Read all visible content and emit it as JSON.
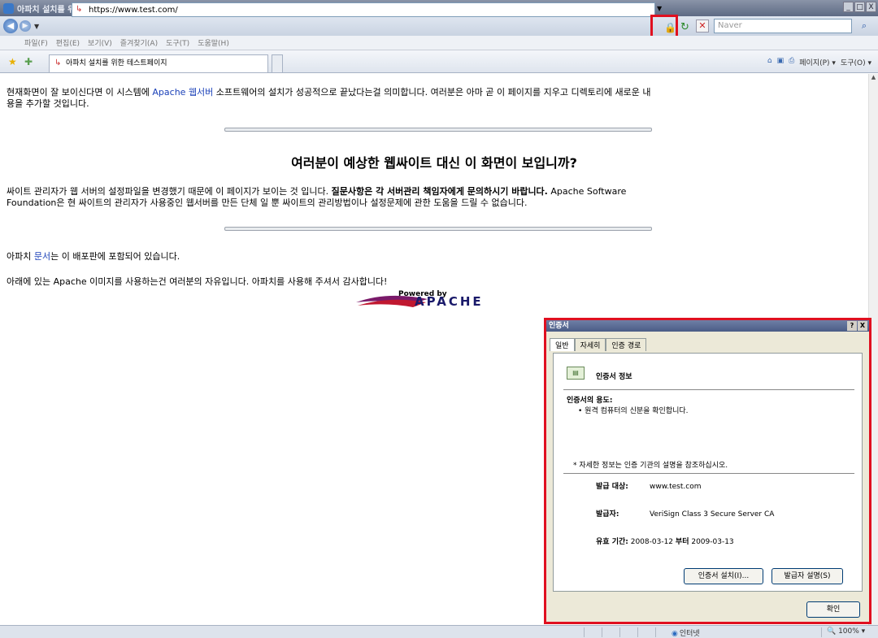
{
  "window": {
    "title": "아파치 설치를 위한 테스트페이지 - Windows Internet Explorer",
    "minimize_glyph": "_",
    "maximize_glyph": "□",
    "close_glyph": "X"
  },
  "toolbar": {
    "back_glyph": "◀",
    "forward_glyph": "▶",
    "dropdown_glyph": "▼",
    "url": "https://www.test.com/",
    "search_placeholder": "Naver",
    "search_glyph": "⌕",
    "stop_glyph": "✕",
    "refresh_glyph": "↻",
    "lock_glyph": "🔒"
  },
  "menu": {
    "items": [
      "파일(F)",
      "편집(E)",
      "보기(V)",
      "즐겨찾기(A)",
      "도구(T)",
      "도움말(H)"
    ]
  },
  "tabs": {
    "active_label": "아파치 설치를 위한 테스트페이지",
    "page_menu": "페이지(P) ▾",
    "tools_menu": "도구(O) ▾",
    "home_glyph": "⌂",
    "feeds_glyph": "▣",
    "print_glyph": "⎙"
  },
  "content": {
    "p1_before": "현재화면이 잘 보이신다면 이 시스템에 ",
    "p1_link": "Apache 웹서버",
    "p1_after": " 소프트웨어의 설치가 성공적으로 끝났다는걸 의미합니다. 여러분은 아마 곧 이 페이지를 지우고 디렉토리에 새로운 내",
    "p1_line2": "용을 추가할 것입니다.",
    "heading": "여러분이 예상한 웹싸이트 대신 이 화면이 보입니까?",
    "p2_before": "싸이트 관리자가 웹 서버의 설정파일을 변경했기 때문에 이 페이지가 보이는 것 입니다. ",
    "p2_bold": "질문사항은 각 서버관리 책임자에게 문의하시기 바랍니다.",
    "p2_after": " Apache Software",
    "p2_line2": "Foundation은 현 싸이트의 관리자가 사용중인 웹서버를 만든 단체 일 뿐 싸이트의 관리방법이나 설정문제에 관한 도움을 드릴 수 없습니다.",
    "p3_before": "아파치 ",
    "p3_link": "문서",
    "p3_after": "는 이 배포판에 포함되어 있습니다.",
    "p4": "아래에 있는 Apache 이미지를 사용하는건 여러분의 자유입니다. 아파치를 사용해 주셔서 감사합니다!",
    "logo_powered": "Powered by",
    "logo_apache": "APACHE"
  },
  "dialog": {
    "title": "인증서",
    "help_glyph": "?",
    "close_glyph": "X",
    "tabs": [
      "일반",
      "자세히",
      "인증 경로"
    ],
    "header": "인증서 정보",
    "purpose_label": "인증서의 용도:",
    "purpose_item": "• 원격 컴퓨터의 신분을 확인합니다.",
    "note": "* 자세한 정보는 인증 기관의 설명을 참조하십시오.",
    "issued_to_label": "발급 대상:",
    "issued_to": "www.test.com",
    "issued_by_label": "발급자:",
    "issued_by": "VeriSign Class 3 Secure Server CA",
    "valid_label": "유효 기간:",
    "valid_from": "2008-03-12",
    "valid_sep": "부터",
    "valid_to": "2009-03-13",
    "install_button": "인증서 설치(I)...",
    "issuer_button": "발급자 설명(S)",
    "ok_button": "확인"
  },
  "status": {
    "zone": "인터넷",
    "zoom": "100%"
  }
}
